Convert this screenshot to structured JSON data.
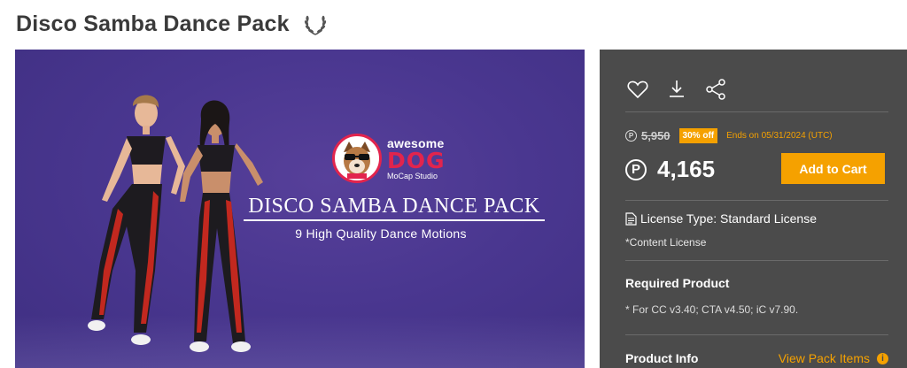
{
  "header": {
    "title": "Disco Samba Dance Pack",
    "badge_icon": "laurel-icon"
  },
  "banner": {
    "logo_awesome": "awesome",
    "logo_dog": "DOG",
    "logo_studio": "MoCap Studio",
    "pack_title": "DISCO SAMBA DANCE PACK",
    "pack_subtitle": "9 High Quality Dance Motions"
  },
  "panel": {
    "actions": [
      {
        "name": "favorite",
        "icon": "heart-icon"
      },
      {
        "name": "download",
        "icon": "download-icon"
      },
      {
        "name": "share",
        "icon": "share-icon"
      }
    ],
    "currency_symbol": "P",
    "original_price": "5,950",
    "discount_label": "30% off",
    "ends_text": "Ends on 05/31/2024 (UTC)",
    "price": "4,165",
    "add_to_cart_label": "Add to Cart",
    "license_type": "License Type: Standard License",
    "license_note": "*Content License",
    "required_product_title": "Required Product",
    "required_product_text": "* For CC v3.40; CTA v4.50; iC v7.90.",
    "product_info_title": "Product Info",
    "view_pack_items_label": "View Pack Items"
  },
  "colors": {
    "accent": "#f5a100",
    "panel_bg": "#4b4b4b",
    "banner_bg": "#4a3790",
    "logo_red": "#e2244d"
  }
}
